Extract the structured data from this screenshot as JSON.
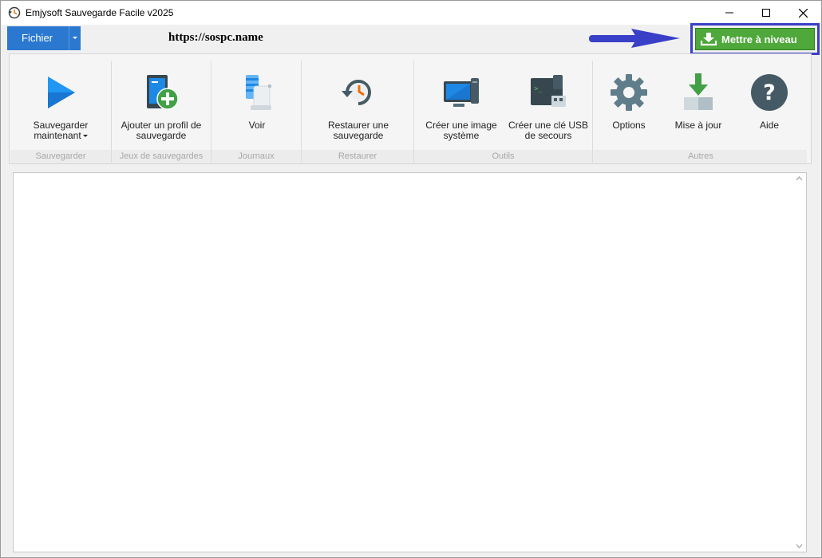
{
  "window": {
    "title": "Emjysoft Sauvegarde Facile v2025",
    "controls": [
      "minimize-icon",
      "maximize-icon",
      "close-icon"
    ]
  },
  "menubar": {
    "fichier_label": "Fichier",
    "url_text": "https://sospc.name",
    "upgrade_label": "Mettre à niveau"
  },
  "ribbon": {
    "items": [
      {
        "label": "Sauvegarder maintenant",
        "icon": "play-icon"
      },
      {
        "label": "Ajouter un profil de sauvegarde",
        "icon": "add-profile-icon"
      },
      {
        "label": "Voir",
        "icon": "journal-icon"
      },
      {
        "label": "Restaurer une sauvegarde",
        "icon": "restore-clock-icon"
      },
      {
        "label": "Créer une image système",
        "icon": "monitor-icon"
      },
      {
        "label": "Créer une clé USB de secours",
        "icon": "usb-terminal-icon"
      },
      {
        "label": "Options",
        "icon": "gear-icon"
      },
      {
        "label": "Mise à jour",
        "icon": "download-update-icon"
      },
      {
        "label": "Aide",
        "icon": "help-icon"
      }
    ],
    "groups": [
      "Sauvegarder",
      "Jeux de sauvegardes",
      "Journaux",
      "Restaurer",
      "Outils",
      "Autres"
    ]
  },
  "colors": {
    "fichier_bg": "#2b78d0",
    "upgrade_bg": "#4ea83a",
    "highlight_border": "#3a3fc8",
    "accent_blue": "#1e88e5"
  }
}
